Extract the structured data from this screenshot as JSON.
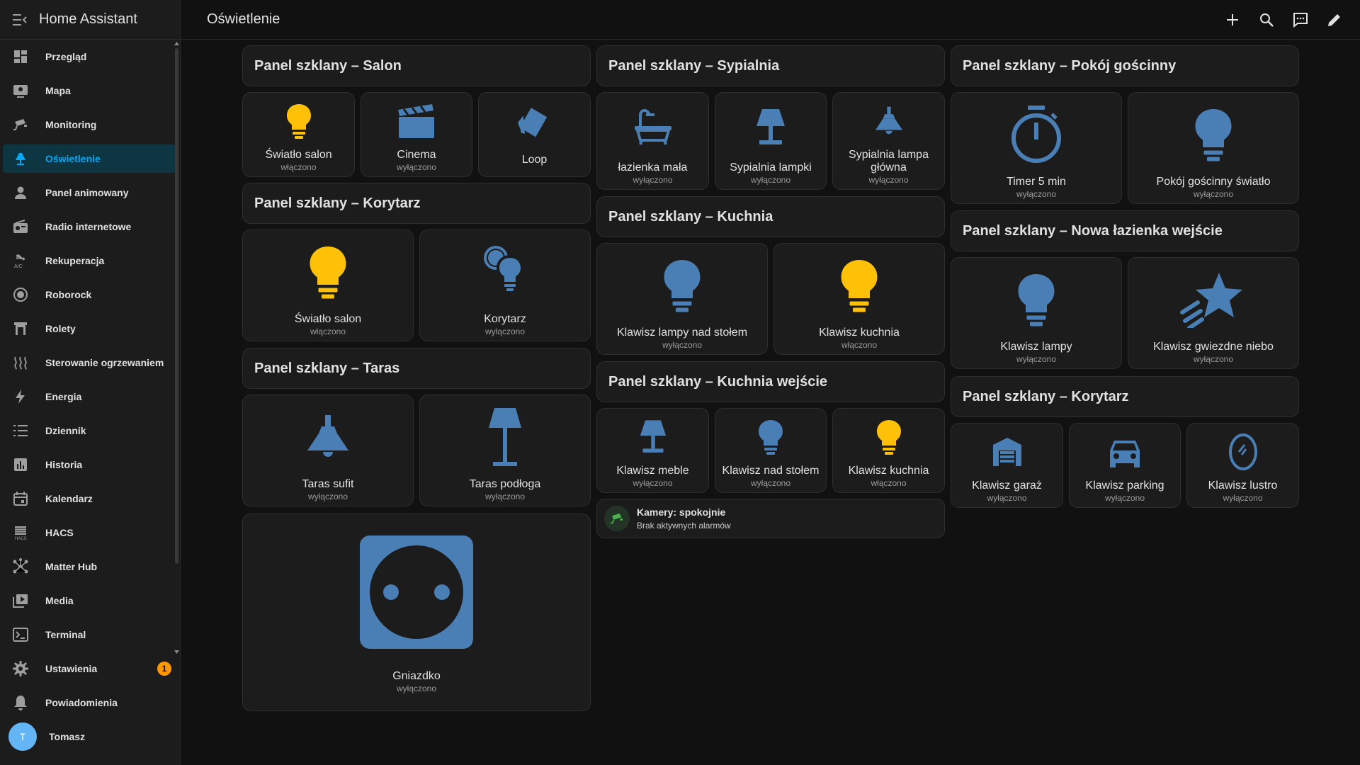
{
  "app": {
    "title": "Home Assistant"
  },
  "topbar": {
    "title": "Oświetlenie",
    "actions": [
      "add-icon",
      "search-icon",
      "assist-icon",
      "edit-icon"
    ]
  },
  "colors": {
    "accent": "#03a9f4",
    "on": "#ffc107",
    "off": "#4a7fb5",
    "badge": "#ff9800"
  },
  "sidebar": {
    "items": [
      {
        "label": "Przegląd",
        "icon": "dashboard-icon"
      },
      {
        "label": "Mapa",
        "icon": "map-icon"
      },
      {
        "label": "Monitoring",
        "icon": "cctv-icon"
      },
      {
        "label": "Oświetlenie",
        "icon": "lamp-icon",
        "active": true
      },
      {
        "label": "Panel animowany",
        "icon": "account-icon"
      },
      {
        "label": "Radio internetowe",
        "icon": "radio-icon"
      },
      {
        "label": "Rekuperacja",
        "icon": "fan-ac-icon"
      },
      {
        "label": "Roborock",
        "icon": "robot-vacuum-icon"
      },
      {
        "label": "Rolety",
        "icon": "blinds-icon"
      },
      {
        "label": "Sterowanie ogrzewaniem",
        "icon": "heating-icon"
      },
      {
        "label": "Energia",
        "icon": "lightning-icon"
      },
      {
        "label": "Dziennik",
        "icon": "list-icon"
      },
      {
        "label": "Historia",
        "icon": "chart-icon"
      },
      {
        "label": "Kalendarz",
        "icon": "calendar-icon"
      },
      {
        "label": "HACS",
        "icon": "hacs-icon"
      },
      {
        "label": "Matter Hub",
        "icon": "hub-icon"
      },
      {
        "label": "Media",
        "icon": "media-icon"
      },
      {
        "label": "Terminal",
        "icon": "terminal-icon"
      }
    ],
    "settings": {
      "label": "Ustawienia",
      "badge": "1"
    },
    "notifications": {
      "label": "Powiadomienia"
    },
    "user": {
      "label": "Tomasz",
      "initial": "T"
    }
  },
  "columns": {
    "col1": {
      "salon": {
        "title": "Panel szklany – Salon",
        "buttons": [
          {
            "name": "Światło salon",
            "state": "włączono"
          },
          {
            "name": "Cinema",
            "state": "wyłączono"
          },
          {
            "name": "Loop",
            "state": ""
          }
        ]
      },
      "korytarz": {
        "title": "Panel szklany – Korytarz",
        "buttons": [
          {
            "name": "Światło salon",
            "state": "włączono"
          },
          {
            "name": "Korytarz",
            "state": "wyłączono"
          }
        ]
      },
      "taras": {
        "title": "Panel szklany – Taras",
        "buttons": [
          {
            "name": "Taras sufit",
            "state": "wyłączono"
          },
          {
            "name": "Taras podłoga",
            "state": "wyłączono"
          }
        ]
      },
      "gniazdko": {
        "name": "Gniazdko",
        "state": "wyłączono"
      }
    },
    "col2": {
      "sypialnia": {
        "title": "Panel szklany – Sypialnia",
        "buttons": [
          {
            "name": "łazienka mała",
            "state": "wyłączono"
          },
          {
            "name": "Sypialnia lampki",
            "state": "wyłączono"
          },
          {
            "name": "Sypialnia lampa główna",
            "state": "wyłączono"
          }
        ]
      },
      "kuchnia": {
        "title": "Panel szklany – Kuchnia",
        "buttons": [
          {
            "name": "Klawisz lampy nad stołem",
            "state": "wyłączono"
          },
          {
            "name": "Klawisz kuchnia",
            "state": "włączono"
          }
        ]
      },
      "kuchnia_wejscie": {
        "title": "Panel szklany – Kuchnia wejście",
        "buttons": [
          {
            "name": "Klawisz meble",
            "state": "wyłączono"
          },
          {
            "name": "Klawisz nad stołem",
            "state": "wyłączono"
          },
          {
            "name": "Klawisz kuchnia",
            "state": "włączono"
          }
        ]
      },
      "alarm": {
        "name": "Kamery: spokojnie",
        "state": "Brak aktywnych alarmów"
      }
    },
    "col3": {
      "goscinny": {
        "title": "Panel szklany – Pokój gościnny",
        "buttons": [
          {
            "name": "Timer 5 min",
            "state": "wyłączono"
          },
          {
            "name": "Pokój gościnny światło",
            "state": "wyłączono"
          }
        ]
      },
      "lazienka": {
        "title": "Panel szklany – Nowa łazienka wejście",
        "buttons": [
          {
            "name": "Klawisz lampy",
            "state": "wyłączono"
          },
          {
            "name": "Klawisz gwiezdne niebo",
            "state": "wyłączono"
          }
        ]
      },
      "korytarz": {
        "title": "Panel szklany – Korytarz",
        "buttons": [
          {
            "name": "Klawisz garaż",
            "state": "wyłączono"
          },
          {
            "name": "Klawisz parking",
            "state": "wyłączono"
          },
          {
            "name": "Klawisz lustro",
            "state": "wyłączono"
          }
        ]
      }
    }
  }
}
